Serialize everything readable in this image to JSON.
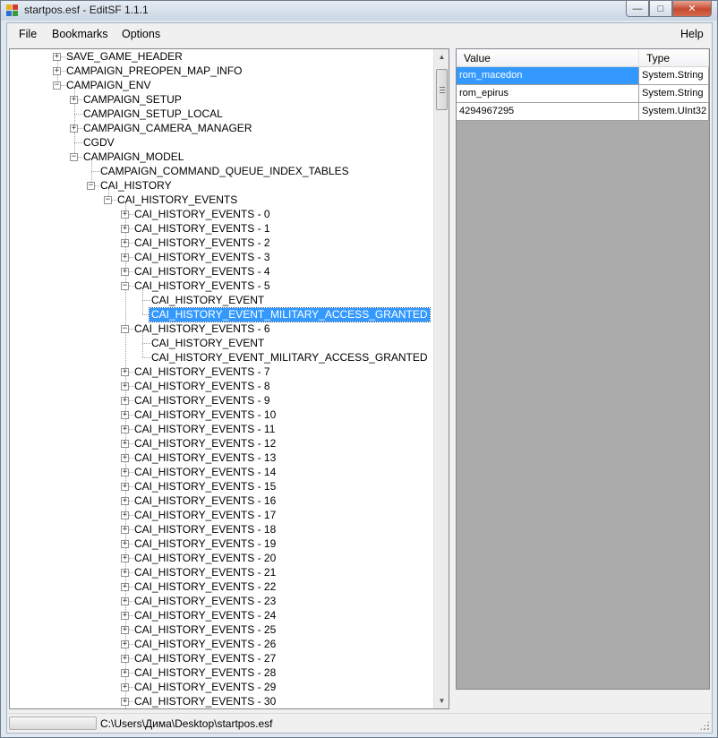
{
  "window": {
    "title": "startpos.esf - EditSF 1.1.1",
    "minimize_glyph": "—",
    "maximize_glyph": "□",
    "close_glyph": "✕"
  },
  "menu": {
    "file": "File",
    "bookmarks": "Bookmarks",
    "options": "Options",
    "help": "Help"
  },
  "tree": {
    "nodes": [
      {
        "label": "SAVE_GAME_HEADER",
        "depth": 0,
        "toggle": "+"
      },
      {
        "label": "CAMPAIGN_PREOPEN_MAP_INFO",
        "depth": 0,
        "toggle": "+"
      },
      {
        "label": "CAMPAIGN_ENV",
        "depth": 0,
        "toggle": "−"
      },
      {
        "label": "CAMPAIGN_SETUP",
        "depth": 1,
        "toggle": "+"
      },
      {
        "label": "CAMPAIGN_SETUP_LOCAL",
        "depth": 1,
        "toggle": ""
      },
      {
        "label": "CAMPAIGN_CAMERA_MANAGER",
        "depth": 1,
        "toggle": "+"
      },
      {
        "label": "CGDV",
        "depth": 1,
        "toggle": ""
      },
      {
        "label": "CAMPAIGN_MODEL",
        "depth": 1,
        "toggle": "−"
      },
      {
        "label": "CAMPAIGN_COMMAND_QUEUE_INDEX_TABLES",
        "depth": 2,
        "toggle": ""
      },
      {
        "label": "CAI_HISTORY",
        "depth": 2,
        "toggle": "−"
      },
      {
        "label": "CAI_HISTORY_EVENTS",
        "depth": 3,
        "toggle": "−"
      },
      {
        "label": "CAI_HISTORY_EVENTS - 0",
        "depth": 4,
        "toggle": "+"
      },
      {
        "label": "CAI_HISTORY_EVENTS - 1",
        "depth": 4,
        "toggle": "+"
      },
      {
        "label": "CAI_HISTORY_EVENTS - 2",
        "depth": 4,
        "toggle": "+"
      },
      {
        "label": "CAI_HISTORY_EVENTS - 3",
        "depth": 4,
        "toggle": "+"
      },
      {
        "label": "CAI_HISTORY_EVENTS - 4",
        "depth": 4,
        "toggle": "+"
      },
      {
        "label": "CAI_HISTORY_EVENTS - 5",
        "depth": 4,
        "toggle": "−"
      },
      {
        "label": "CAI_HISTORY_EVENT",
        "depth": 5,
        "toggle": ""
      },
      {
        "label": "CAI_HISTORY_EVENT_MILITARY_ACCESS_GRANTED",
        "depth": 5,
        "toggle": "",
        "selected": true
      },
      {
        "label": "CAI_HISTORY_EVENTS - 6",
        "depth": 4,
        "toggle": "−"
      },
      {
        "label": "CAI_HISTORY_EVENT",
        "depth": 5,
        "toggle": ""
      },
      {
        "label": "CAI_HISTORY_EVENT_MILITARY_ACCESS_GRANTED",
        "depth": 5,
        "toggle": ""
      },
      {
        "label": "CAI_HISTORY_EVENTS - 7",
        "depth": 4,
        "toggle": "+"
      },
      {
        "label": "CAI_HISTORY_EVENTS - 8",
        "depth": 4,
        "toggle": "+"
      },
      {
        "label": "CAI_HISTORY_EVENTS - 9",
        "depth": 4,
        "toggle": "+"
      },
      {
        "label": "CAI_HISTORY_EVENTS - 10",
        "depth": 4,
        "toggle": "+"
      },
      {
        "label": "CAI_HISTORY_EVENTS - 11",
        "depth": 4,
        "toggle": "+"
      },
      {
        "label": "CAI_HISTORY_EVENTS - 12",
        "depth": 4,
        "toggle": "+"
      },
      {
        "label": "CAI_HISTORY_EVENTS - 13",
        "depth": 4,
        "toggle": "+"
      },
      {
        "label": "CAI_HISTORY_EVENTS - 14",
        "depth": 4,
        "toggle": "+"
      },
      {
        "label": "CAI_HISTORY_EVENTS - 15",
        "depth": 4,
        "toggle": "+"
      },
      {
        "label": "CAI_HISTORY_EVENTS - 16",
        "depth": 4,
        "toggle": "+"
      },
      {
        "label": "CAI_HISTORY_EVENTS - 17",
        "depth": 4,
        "toggle": "+"
      },
      {
        "label": "CAI_HISTORY_EVENTS - 18",
        "depth": 4,
        "toggle": "+"
      },
      {
        "label": "CAI_HISTORY_EVENTS - 19",
        "depth": 4,
        "toggle": "+"
      },
      {
        "label": "CAI_HISTORY_EVENTS - 20",
        "depth": 4,
        "toggle": "+"
      },
      {
        "label": "CAI_HISTORY_EVENTS - 21",
        "depth": 4,
        "toggle": "+"
      },
      {
        "label": "CAI_HISTORY_EVENTS - 22",
        "depth": 4,
        "toggle": "+"
      },
      {
        "label": "CAI_HISTORY_EVENTS - 23",
        "depth": 4,
        "toggle": "+"
      },
      {
        "label": "CAI_HISTORY_EVENTS - 24",
        "depth": 4,
        "toggle": "+"
      },
      {
        "label": "CAI_HISTORY_EVENTS - 25",
        "depth": 4,
        "toggle": "+"
      },
      {
        "label": "CAI_HISTORY_EVENTS - 26",
        "depth": 4,
        "toggle": "+"
      },
      {
        "label": "CAI_HISTORY_EVENTS - 27",
        "depth": 4,
        "toggle": "+"
      },
      {
        "label": "CAI_HISTORY_EVENTS - 28",
        "depth": 4,
        "toggle": "+"
      },
      {
        "label": "CAI_HISTORY_EVENTS - 29",
        "depth": 4,
        "toggle": "+"
      },
      {
        "label": "CAI_HISTORY_EVENTS - 30",
        "depth": 4,
        "toggle": "+"
      }
    ]
  },
  "grid": {
    "columns": [
      "Value",
      "Type"
    ],
    "rows": [
      {
        "value": "rom_macedon",
        "type": "System.String",
        "selected": true
      },
      {
        "value": "rom_epirus",
        "type": "System.String",
        "selected": false
      },
      {
        "value": "4294967295",
        "type": "System.UInt32",
        "selected": false
      }
    ]
  },
  "status": {
    "path": "C:\\Users\\Дима\\Desktop\\startpos.esf"
  },
  "colors": {
    "selection": "#3399ff",
    "grid_background": "#ababab"
  }
}
